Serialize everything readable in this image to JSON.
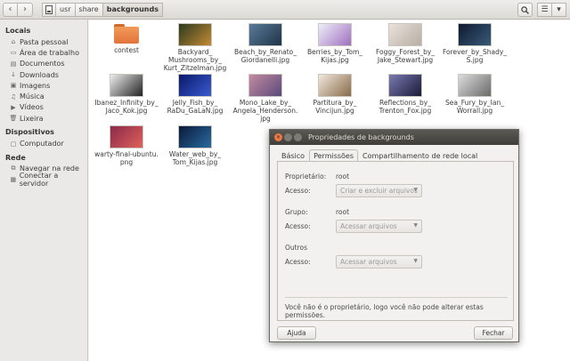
{
  "toolbar": {
    "back_icon": "‹",
    "forward_icon": "›",
    "breadcrumbs": [
      "usr",
      "share",
      "backgrounds"
    ],
    "search_icon": "⚲",
    "list_icon": "☰",
    "menu_icon": "▾"
  },
  "sidebar": {
    "sections": [
      {
        "title": "Locais",
        "items": [
          {
            "icon": "⌂",
            "label": "Pasta pessoal"
          },
          {
            "icon": "▭",
            "label": "Área de trabalho"
          },
          {
            "icon": "▤",
            "label": "Documentos"
          },
          {
            "icon": "↓",
            "label": "Downloads"
          },
          {
            "icon": "▣",
            "label": "Imagens"
          },
          {
            "icon": "♫",
            "label": "Música"
          },
          {
            "icon": "▶",
            "label": "Vídeos"
          },
          {
            "icon": "🗑",
            "label": "Lixeira"
          }
        ]
      },
      {
        "title": "Dispositivos",
        "items": [
          {
            "icon": "▢",
            "label": "Computador"
          }
        ]
      },
      {
        "title": "Rede",
        "items": [
          {
            "icon": "⧉",
            "label": "Navegar na rede"
          },
          {
            "icon": "▦",
            "label": "Conectar a servidor"
          }
        ]
      }
    ]
  },
  "files": [
    {
      "name": "contest",
      "type": "folder",
      "colors": [
        "#f29a5a",
        "#e2743a"
      ]
    },
    {
      "name": "Backyard_\nMushrooms_by_\nKurt_Zitzelman.jpg",
      "type": "image",
      "colors": [
        "#2b3a1e",
        "#c48a34"
      ]
    },
    {
      "name": "Beach_by_Renato_\nGiordanelli.jpg",
      "type": "image",
      "colors": [
        "#5a7a98",
        "#1f3448"
      ]
    },
    {
      "name": "Berries_by_Tom_\nKijas.jpg",
      "type": "image",
      "colors": [
        "#eeeef8",
        "#a070c0"
      ]
    },
    {
      "name": "Foggy_Forest_by_\nJake_Stewart.jpg",
      "type": "image",
      "colors": [
        "#e8e2dc",
        "#b8aea4"
      ]
    },
    {
      "name": "Forever_by_Shady_\nS.jpg",
      "type": "image",
      "colors": [
        "#0e1a30",
        "#3a5a7a"
      ]
    },
    {
      "name": "Ibanez_Infinity_by_\nJaco_Kok.jpg",
      "type": "image",
      "colors": [
        "#eeeeee",
        "#222222"
      ]
    },
    {
      "name": "Jelly_Fish_by_\nRaDu_GaLaN.jpg",
      "type": "image",
      "colors": [
        "#0a1a6a",
        "#3a5ad0"
      ]
    },
    {
      "name": "Mono_Lake_by_\nAngela_Henderson.\njpg",
      "type": "image",
      "colors": [
        "#c48aa0",
        "#5a4a7a"
      ]
    },
    {
      "name": "Partitura_by_\nVincijun.jpg",
      "type": "image",
      "colors": [
        "#f0e8dc",
        "#8a6a4a"
      ]
    },
    {
      "name": "Reflections_by_\nTrenton_Fox.jpg",
      "type": "image",
      "colors": [
        "#7a7ab0",
        "#1a1a3a"
      ]
    },
    {
      "name": "Sea_Fury_by_Ian_\nWorrall.jpg",
      "type": "image",
      "colors": [
        "#dcdcdc",
        "#6a6a6a"
      ]
    },
    {
      "name": "warty-final-ubuntu.\npng",
      "type": "image",
      "colors": [
        "#8a2a4a",
        "#e0605a"
      ]
    },
    {
      "name": "Water_web_by_\nTom_Kijas.jpg",
      "type": "image",
      "colors": [
        "#0a1a3a",
        "#2a6aa0"
      ]
    }
  ],
  "dialog": {
    "title": "Propriedades de backgrounds",
    "tabs": [
      "Básico",
      "Permissões",
      "Compartilhamento de rede local"
    ],
    "owner_label": "Proprietário:",
    "owner_value": "root",
    "access_label": "Acesso:",
    "owner_access": "Criar e excluir arquivos",
    "group_label": "Grupo:",
    "group_value": "root",
    "group_access": "Acessar arquivos",
    "others_label": "Outros",
    "others_access": "Acessar arquivos",
    "note": "Você não é o proprietário, logo você não pode alterar estas permissões.",
    "help_button": "Ajuda",
    "close_button": "Fechar"
  }
}
